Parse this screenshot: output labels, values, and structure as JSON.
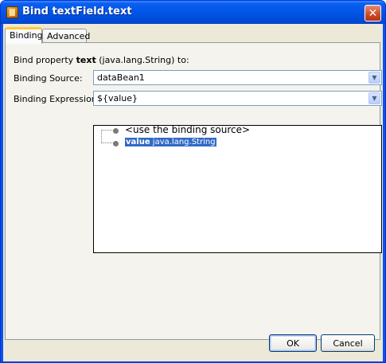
{
  "window": {
    "title": "Bind textField.text"
  },
  "tabs": [
    {
      "label": "Binding",
      "active": true
    },
    {
      "label": "Advanced",
      "active": false
    }
  ],
  "binding": {
    "prompt_prefix": "Bind property ",
    "property_name": "text",
    "prompt_suffix": " (java.lang.String) to:",
    "source_label": "Binding Source:",
    "source_value": "dataBean1",
    "expression_label": "Binding Expression:",
    "expression_value": "${value}"
  },
  "tree": {
    "items": [
      {
        "label": "<use the binding source>"
      },
      {
        "name": "value",
        "type": "java.lang.String",
        "selected": true
      }
    ]
  },
  "buttons": {
    "ok": "OK",
    "cancel": "Cancel"
  },
  "icons": {
    "close": "close-icon",
    "app": "app-icon",
    "dropdown": "chevron-down-icon"
  }
}
